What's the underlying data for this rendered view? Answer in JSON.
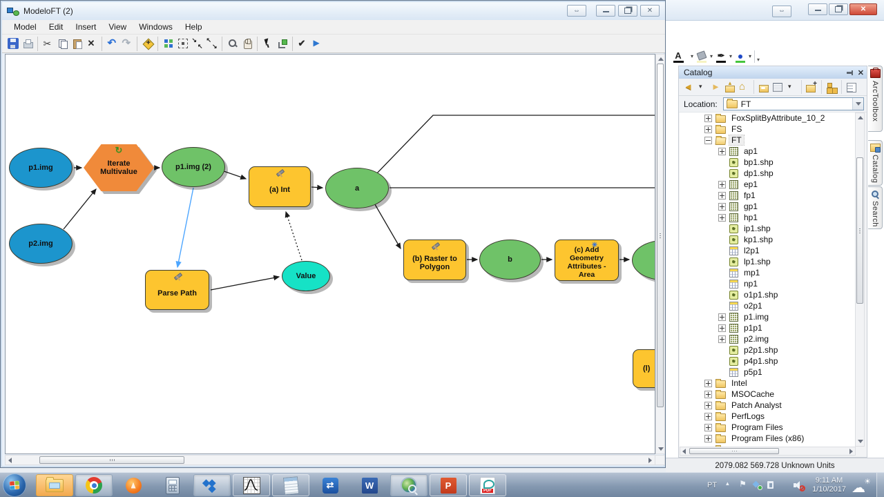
{
  "colors": {
    "input_blue": "#1c95cd",
    "derived_green": "#6fc268",
    "tool_yellow": "#fdc52f",
    "iterator_orange": "#f08a3a",
    "value_cyan": "#16e2c6",
    "edge_black": "#1c1c1c",
    "feedback_blue": "#4da6ff",
    "close_red": "#cf4a38",
    "taskbar_blue": "#8599b1"
  },
  "model_window": {
    "title": "ModeloFT (2)",
    "menu": [
      "Model",
      "Edit",
      "Insert",
      "View",
      "Windows",
      "Help"
    ],
    "toolbar_icons": [
      "save-icon",
      "print-icon",
      "cut-icon",
      "copy-icon",
      "paste-icon",
      "delete-icon",
      "undo-icon",
      "redo-icon",
      "add-data-icon",
      "auto-layout-icon",
      "full-extent-icon",
      "fixed-zoom-in-icon",
      "fixed-zoom-out-icon",
      "zoom-icon",
      "pan-icon",
      "select-icon",
      "connect-icon",
      "validate-icon",
      "run-icon"
    ],
    "window_buttons": [
      "resize-toggle",
      "minimize",
      "restore",
      "close"
    ]
  },
  "arcmap": {
    "window_buttons": [
      "resize-toggle",
      "minimize",
      "restore",
      "close"
    ],
    "draw_toolbar": {
      "font_glyph": "A",
      "icons": [
        "font-color-icon",
        "fill-color-icon",
        "line-color-icon",
        "marker-color-icon",
        "toolbar-overflow-icon"
      ]
    }
  },
  "model": {
    "nodes": [
      {
        "label": "p1.img",
        "type": "input-data"
      },
      {
        "label": "p2.img",
        "type": "input-data"
      },
      {
        "label": "Iterate Multivalue",
        "type": "iterator"
      },
      {
        "label": "p1.img (2)",
        "type": "derived-data"
      },
      {
        "label": "(a) Int",
        "type": "tool"
      },
      {
        "label": "a",
        "type": "derived-data"
      },
      {
        "label": "Parse Path",
        "type": "tool"
      },
      {
        "label": "Value",
        "type": "derived-value"
      },
      {
        "label": "(b) Raster to Polygon",
        "type": "tool"
      },
      {
        "label": "b",
        "type": "derived-data"
      },
      {
        "label": "(c) Add Geometry Attributes - Area",
        "type": "tool"
      },
      {
        "label": "",
        "type": "derived-data"
      },
      {
        "label": "(l)",
        "type": "tool"
      }
    ]
  },
  "catalog": {
    "title": "Catalog",
    "toolbar_icons": [
      "back-icon",
      "dropdown-icon",
      "forward-icon",
      "up-one-level-icon",
      "home-icon",
      "default-gdb-icon",
      "contents-view-icon",
      "dropdown-icon",
      "connect-folder-icon",
      "toc-icon",
      "options-icon"
    ],
    "location_label": "Location:",
    "location_value": "FT",
    "tree": [
      {
        "label": "FoxSplitByAttribute_10_2",
        "icon": "folder-closed-icon",
        "expander": "plus",
        "indent": "lvl1"
      },
      {
        "label": "FS",
        "icon": "folder-closed-icon",
        "expander": "plus",
        "indent": "lvl1"
      },
      {
        "label": "FT",
        "icon": "folder-open-icon",
        "expander": "minus",
        "indent": "lvl1",
        "hl": "hl"
      },
      {
        "label": "ap1",
        "icon": "raster-icon",
        "expander": "plus",
        "indent": "lvl2"
      },
      {
        "label": "bp1.shp",
        "icon": "shapefile-icon",
        "expander": "none",
        "indent": "lvl2"
      },
      {
        "label": "dp1.shp",
        "icon": "shapefile-icon",
        "expander": "none",
        "indent": "lvl2"
      },
      {
        "label": "ep1",
        "icon": "raster-icon",
        "expander": "plus",
        "indent": "lvl2"
      },
      {
        "label": "fp1",
        "icon": "raster-icon",
        "expander": "plus",
        "indent": "lvl2"
      },
      {
        "label": "gp1",
        "icon": "raster-icon",
        "expander": "plus",
        "indent": "lvl2"
      },
      {
        "label": "hp1",
        "icon": "raster-icon",
        "expander": "plus",
        "indent": "lvl2"
      },
      {
        "label": "ip1.shp",
        "icon": "shapefile-icon",
        "expander": "none",
        "indent": "lvl2"
      },
      {
        "label": "kp1.shp",
        "icon": "shapefile-icon",
        "expander": "none",
        "indent": "lvl2"
      },
      {
        "label": "l2p1",
        "icon": "table-icon",
        "expander": "none",
        "indent": "lvl2"
      },
      {
        "label": "lp1.shp",
        "icon": "shapefile-icon",
        "expander": "none",
        "indent": "lvl2"
      },
      {
        "label": "mp1",
        "icon": "table-icon",
        "expander": "none",
        "indent": "lvl2"
      },
      {
        "label": "np1",
        "icon": "table-icon",
        "expander": "none",
        "indent": "lvl2"
      },
      {
        "label": "o1p1.shp",
        "icon": "shapefile-icon",
        "expander": "none",
        "indent": "lvl2"
      },
      {
        "label": "o2p1",
        "icon": "table-icon",
        "expander": "none",
        "indent": "lvl2"
      },
      {
        "label": "p1.img",
        "icon": "raster-icon",
        "expander": "plus",
        "indent": "lvl2"
      },
      {
        "label": "p1p1",
        "icon": "raster-icon",
        "expander": "plus",
        "indent": "lvl2"
      },
      {
        "label": "p2.img",
        "icon": "raster-icon",
        "expander": "plus",
        "indent": "lvl2"
      },
      {
        "label": "p2p1.shp",
        "icon": "shapefile-icon",
        "expander": "none",
        "indent": "lvl2"
      },
      {
        "label": "p4p1.shp",
        "icon": "shapefile-icon",
        "expander": "none",
        "indent": "lvl2"
      },
      {
        "label": "p5p1",
        "icon": "table-icon",
        "expander": "none",
        "indent": "lvl2"
      },
      {
        "label": "Intel",
        "icon": "folder-closed-icon",
        "expander": "plus",
        "indent": "lvl1"
      },
      {
        "label": "MSOCache",
        "icon": "folder-closed-icon",
        "expander": "plus",
        "indent": "lvl1"
      },
      {
        "label": "Patch Analyst",
        "icon": "folder-closed-icon",
        "expander": "plus",
        "indent": "lvl1"
      },
      {
        "label": "PerfLogs",
        "icon": "folder-closed-icon",
        "expander": "plus",
        "indent": "lvl1"
      },
      {
        "label": "Program Files",
        "icon": "folder-closed-icon",
        "expander": "plus",
        "indent": "lvl1"
      },
      {
        "label": "Program Files (x86)",
        "icon": "folder-closed-icon",
        "expander": "plus",
        "indent": "lvl1"
      },
      {
        "label": "",
        "icon": "folder-closed-icon",
        "expander": "none",
        "indent": "lvl1"
      }
    ]
  },
  "side_tabs": [
    {
      "label": "ArcToolbox",
      "icon": "toolbox-icon"
    },
    {
      "label": "Catalog",
      "icon": "catalog-folder-icon"
    },
    {
      "label": "Search",
      "icon": "search-icon"
    }
  ],
  "status_bar": {
    "text": "2079.082  569.728 Unknown Units"
  },
  "taskbar": {
    "apps": [
      "start",
      "windows-explorer",
      "chrome",
      "avast",
      "calculator",
      "dropbox",
      "curve-plotter",
      "notepad",
      "teamviewer",
      "word",
      "arcmap",
      "powerpoint",
      "pdf-reader"
    ],
    "app_glyphs": {
      "teamviewer": "⇄",
      "word": "W",
      "powerpoint": "P",
      "pdf": "PDF"
    },
    "tray": {
      "language": "PT",
      "time": "9:11 AM",
      "date": "1/10/2017",
      "icons": [
        "hidden-icons-chevron",
        "action-center-flag-icon",
        "dropbox-sync-icon",
        "power-plan-icon",
        "network-signal-icon",
        "volume-muted-icon",
        "weather-icon"
      ]
    }
  }
}
